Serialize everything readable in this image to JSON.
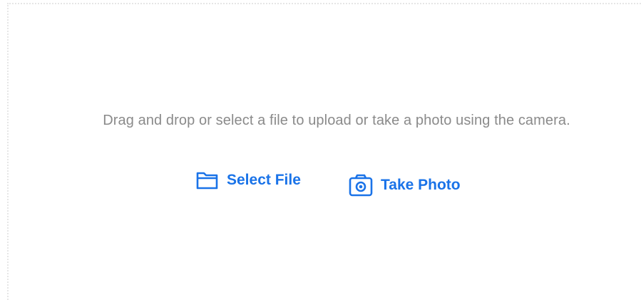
{
  "dropzone": {
    "instructions": "Drag and drop or select a file to upload or take a photo using the camera."
  },
  "actions": {
    "select_file": {
      "label": "Select File",
      "icon": "folder-icon"
    },
    "take_photo": {
      "label": "Take Photo",
      "icon": "camera-icon"
    }
  },
  "colors": {
    "accent": "#1a73e8",
    "instruction_text": "#8a8a8a",
    "dropzone_border": "#e6e6e6"
  }
}
